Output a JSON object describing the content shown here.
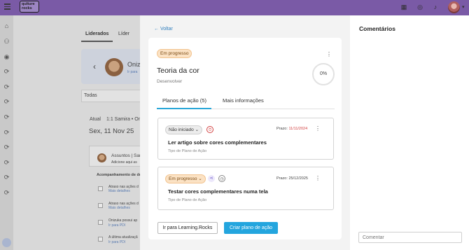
{
  "topbar": {
    "logo_text": "qulture rocks",
    "icons": [
      "menu-icon",
      "apps-grid-icon",
      "help-icon",
      "bell-icon",
      "avatar"
    ]
  },
  "background": {
    "tabs": [
      "Liderados",
      "Líder"
    ],
    "filter_label": "Todas",
    "person_name": "Oniz",
    "person_link": "Ir para",
    "status_line": "Atual",
    "meeting_line": "1:1 Samira • Oniz",
    "date_label": "Sex, 11 Nov 25",
    "subject_title": "Assuntos | Sam",
    "subject_desc": "Adicione aqui as",
    "follow_label": "Acompanhamento de de",
    "items": [
      {
        "text": "Atraso nas ações d",
        "link": "Mais detalhes"
      },
      {
        "text": "Atraso nas ações d",
        "link": "Mais detalhes"
      },
      {
        "text": "Onizuka possui ap",
        "link": "Ir para PDI"
      },
      {
        "text": "A última atualizaçã",
        "link": "Ir para PDI"
      }
    ]
  },
  "drawer": {
    "back_label": "Voltar",
    "status_badge": "Em progresso",
    "title": "Teoria da cor",
    "subtitle": "Desenvolver",
    "progress": "0%",
    "tabs": [
      "Planos de ação (5)",
      "Mais informações"
    ],
    "plans": [
      {
        "status": "Não iniciado",
        "deadline_label": "Prazo:",
        "deadline": "11/11/2024",
        "late": true,
        "title": "Ler artigo sobre cores complementares",
        "type": "Tipo de Plano de Ação"
      },
      {
        "status": "Em progresso",
        "deadline_label": "Prazo:",
        "deadline": "25/12/2025",
        "late": false,
        "title": "Testar cores complementares numa tela",
        "type": "Tipo de Plano de Ação"
      }
    ],
    "learning_button": "Ir para Learning.Rocks",
    "create_button": "Criar plano de ação"
  },
  "comments": {
    "title": "Comentários",
    "input_placeholder": "Comentar"
  },
  "colors": {
    "topbar": "#7a5aa6",
    "accent": "#23a5de",
    "late": "#d24040",
    "badge_progress_bg": "#fbe2c4"
  }
}
